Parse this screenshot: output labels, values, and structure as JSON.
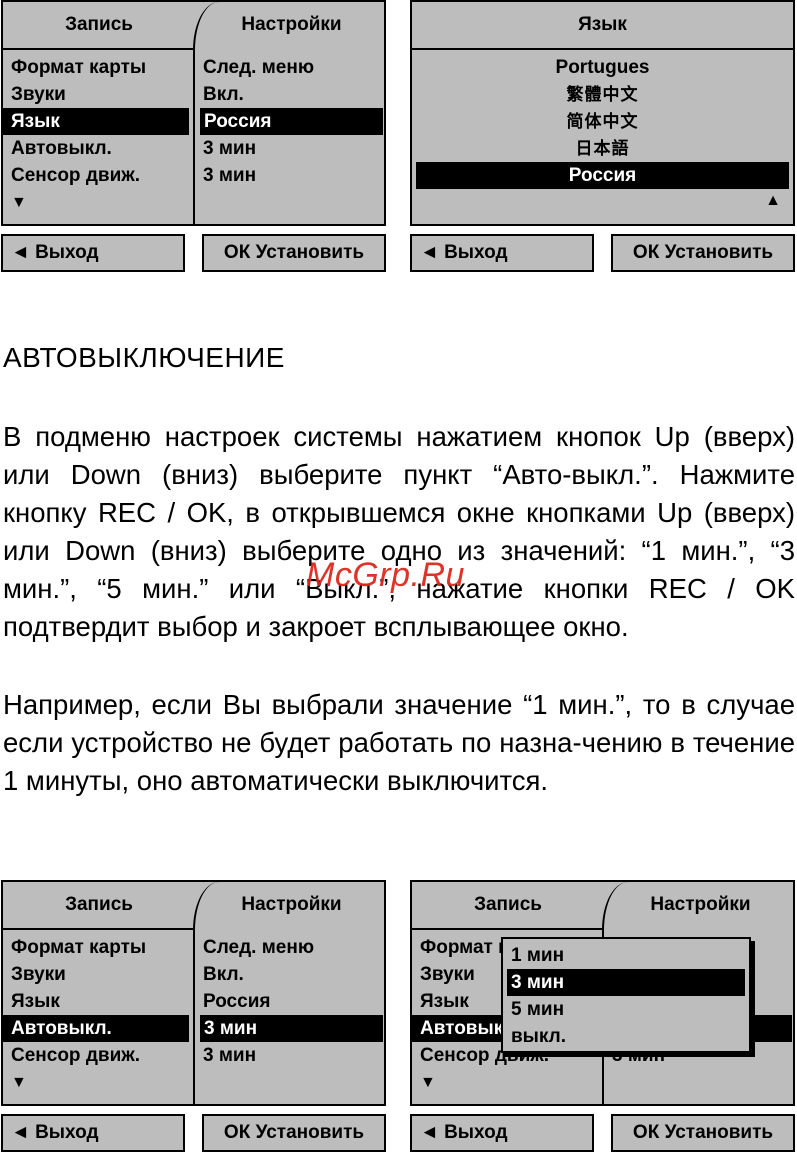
{
  "menu": {
    "tab_record": "Запись",
    "tab_settings": "Настройки",
    "left_items": [
      "Формат карты",
      "Звуки",
      "Язык",
      "Автовыкл.",
      "Сенсор движ."
    ],
    "right_values": [
      "След. меню",
      "Вкл.",
      "Россия",
      "3 мин",
      "3 мин"
    ],
    "more_arrow": "▼",
    "exit_label": "◄ Выход",
    "ok_label": "ОК Установить"
  },
  "language": {
    "title": "Язык",
    "options": [
      "Portugues",
      "繁體中文",
      "简体中文",
      "日本語",
      "Россия"
    ],
    "up_arrow": "▲"
  },
  "popup": {
    "options": [
      "1 мин",
      "3 мин",
      "5 мин",
      "выкл."
    ]
  },
  "article": {
    "heading": "АВТОВЫКЛЮЧЕНИЕ",
    "para1": "В подменю настроек системы нажатием кнопок Up (вверх) или Down (вниз) выберите пункт “Авто-выкл.”. Нажмите кнопку REC / OK, в открывшемся окне кнопками Up (вверх) или Down (вниз) выберите одно из значений: “1 мин.”, “3 мин.”, “5 мин.” или “Выкл.”, нажатие кнопки REC / OK подтвердит выбор и закроет всплывающее окно.",
    "para2": "Например, если Вы выбрали значение “1 мин.”, то в случае если устройство не будет работать по назна-чению в течение 1 минуты, оно автоматически выключится.",
    "watermark": "McGrp.Ru"
  }
}
